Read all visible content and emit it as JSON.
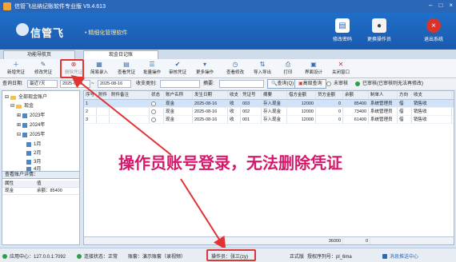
{
  "window": {
    "title": "信管飞出纳记账软件专业版 V9.4.613"
  },
  "banner": {
    "logo": "信管飞",
    "slogan": "• 精细化管理软件",
    "nav": [
      {
        "label": "修改密码",
        "icon": "password-icon"
      },
      {
        "label": "更换操作员",
        "icon": "user-switch-icon"
      },
      {
        "label": "退出系统",
        "icon": "exit-icon"
      }
    ]
  },
  "tabs": [
    {
      "label": "功能导航页"
    },
    {
      "label": "现金日记账"
    }
  ],
  "toolbar": [
    {
      "label": "新增凭证",
      "icon": "add-icon"
    },
    {
      "label": "修改凭证",
      "icon": "edit-icon"
    },
    {
      "label": "删除凭证",
      "icon": "delete-icon"
    },
    {
      "label": "简易录入",
      "icon": "quick-entry-icon"
    },
    {
      "label": "查看凭证",
      "icon": "view-icon"
    },
    {
      "label": "批量操作",
      "icon": "batch-icon"
    },
    {
      "label": "审核凭证",
      "icon": "audit-icon"
    },
    {
      "label": "更多操作",
      "icon": "more-icon"
    },
    {
      "label": "查看修改",
      "icon": "history-icon"
    },
    {
      "label": "导入导出",
      "icon": "import-export-icon"
    },
    {
      "label": "打印",
      "icon": "print-icon"
    },
    {
      "label": "界面设计",
      "icon": "design-icon"
    },
    {
      "label": "关闭窗口",
      "icon": "close-icon"
    }
  ],
  "filter": {
    "date_label": "查询日期:",
    "date_range": "最近7天",
    "date_from": "2025-08-0",
    "date_to": "2025-08-16",
    "category_label": "收支类别:",
    "summary_label": "摘要:",
    "search_button": "查询(Q)",
    "advanced_button": "高级查询",
    "legend_unaudited": "未审核",
    "legend_audited": "已审核(已审核则无法再修改)"
  },
  "tree": {
    "root": "全部现金账户",
    "account": "现金",
    "years": [
      "2023年",
      "2024年",
      "2025年"
    ],
    "months": [
      "1月",
      "2月",
      "3月",
      "4月"
    ]
  },
  "account_detail": {
    "title": "查看账户详情：",
    "headers": [
      "属性",
      "值"
    ],
    "rows": [
      [
        "现金",
        "余额：85400"
      ]
    ]
  },
  "table": {
    "headers": [
      "序号",
      "附件",
      "附件备注",
      "状态",
      "账户名称",
      "发生日期",
      "收支",
      "凭证号",
      "摘要",
      "借方金额",
      "贷方金额",
      "余额",
      "制单人",
      "方向",
      "收支"
    ],
    "rows": [
      [
        "1",
        "",
        "",
        "",
        "现金",
        "2025-08-16",
        "收",
        "003",
        "存入现金",
        "12000",
        "0",
        "85400",
        "系统管理员",
        "借",
        "销售收"
      ],
      [
        "2",
        "",
        "",
        "",
        "现金",
        "2025-08-16",
        "收",
        "002",
        "存入现金",
        "12000",
        "0",
        "73400",
        "系统管理员",
        "借",
        "销售收"
      ],
      [
        "3",
        "",
        "",
        "",
        "现金",
        "2025-08-16",
        "收",
        "001",
        "存入现金",
        "12000",
        "0",
        "61400",
        "系统管理员",
        "借",
        "销售收"
      ]
    ],
    "footer_total": "36000",
    "footer_credit": "0"
  },
  "status": {
    "app_center": "应用中心：127.0.0.1:7092",
    "connection": "连接状态：正常",
    "ledger": "账套：演示账套（录视频）",
    "operator": "操作员：张三(zy)",
    "edition": "正式版",
    "serial": "授权序列号：pl_6ma",
    "service": "消息推送中心"
  },
  "annotation": {
    "text": "操作员账号登录，无法删除凭证"
  },
  "colors": {
    "accent": "#2a67b8",
    "annotation": "#d6186b",
    "highlight": "#e23232"
  }
}
